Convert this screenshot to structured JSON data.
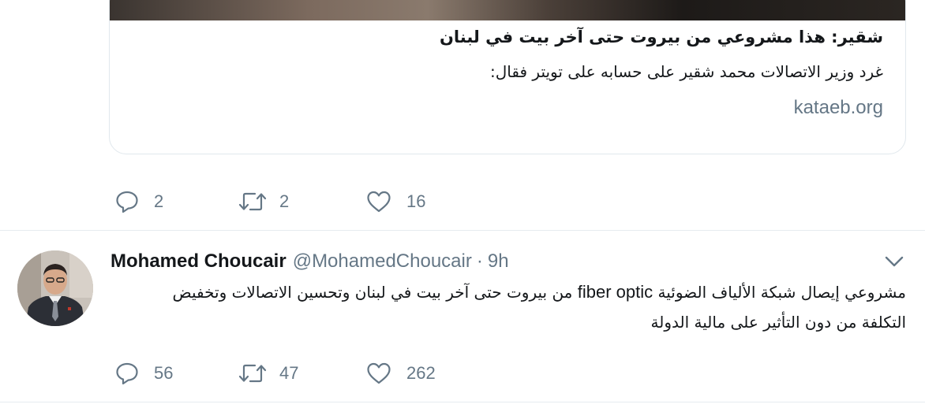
{
  "quoted_tweet": {
    "card": {
      "title": "شقير: هذا مشروعي من بيروت حتى آخر بيت في لبنان",
      "description": "غرد وزير الاتصالات محمد شقير على حسابه على تويتر فقال:",
      "domain": "kataeb.org"
    },
    "actions": {
      "replies": "2",
      "retweets": "2",
      "likes": "16"
    }
  },
  "tweet": {
    "author_name": "Mohamed Choucair",
    "handle": "@MohamedChoucair",
    "separator": "·",
    "time": "9h",
    "text_part1": "مشروعي إيصال شبكة الألياف الضوئية ",
    "text_ltr": "fiber optic",
    "text_part2": " من بيروت حتى آخر بيت في لبنان وتحسين الاتصالات وتخفيض التكلفة من دون التأثير على مالية الدولة",
    "actions": {
      "replies": "56",
      "retweets": "47",
      "likes": "262"
    }
  },
  "icons": {
    "reply": "reply-icon",
    "retweet": "retweet-icon",
    "like": "heart-icon",
    "more": "chevron-down-icon"
  },
  "colors": {
    "text": "#14171a",
    "secondary": "#657786",
    "border": "#e1e8ed"
  }
}
